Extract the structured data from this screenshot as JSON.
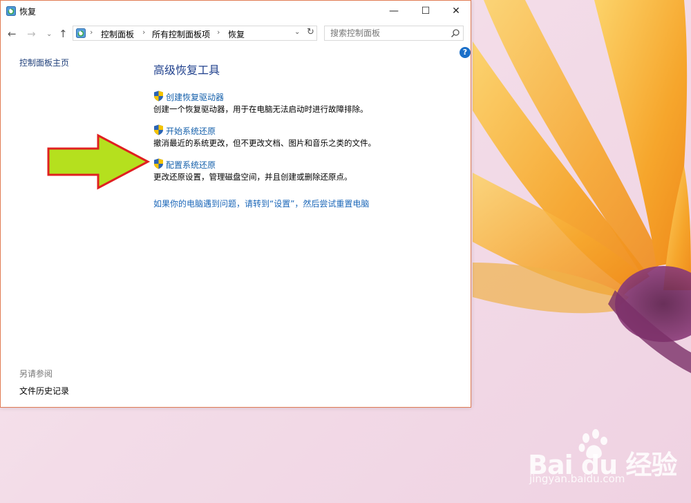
{
  "window": {
    "title": "恢复",
    "controls": {
      "minimize": "—",
      "maximize": "☐",
      "close": "✕"
    }
  },
  "nav": {
    "back": "←",
    "forward": "→",
    "recent": "⌄",
    "up": "↑",
    "breadcrumbs": [
      "控制面板",
      "所有控制面板项",
      "恢复"
    ],
    "separator": "›",
    "dropdown": "⌄",
    "refresh": "↻",
    "search_placeholder": "搜索控制面板"
  },
  "help": "?",
  "sidebar": {
    "home": "控制面板主页",
    "see_also_label": "另请参阅",
    "see_also_items": [
      "文件历史记录"
    ]
  },
  "main": {
    "title": "高级恢复工具",
    "tasks": [
      {
        "label": "创建恢复驱动器",
        "desc": "创建一个恢复驱动器，用于在电脑无法启动时进行故障排除。"
      },
      {
        "label": "开始系统还原",
        "desc": "撤消最近的系统更改，但不更改文档、图片和音乐之类的文件。"
      },
      {
        "label": "配置系统还原",
        "desc": "更改还原设置，管理磁盘空间，并且创建或删除还原点。"
      }
    ],
    "reset_link": "如果你的电脑遇到问题，请转到“设置”，然后尝试重置电脑"
  },
  "watermark": {
    "logo": "Bai du 经验",
    "url": "jingyan.baidu.com"
  },
  "colors": {
    "window_border": "#e07b53",
    "link": "#1560ab",
    "title": "#1e3f8c",
    "arrow_fill": "#b5e01e",
    "arrow_stroke": "#e02020"
  }
}
